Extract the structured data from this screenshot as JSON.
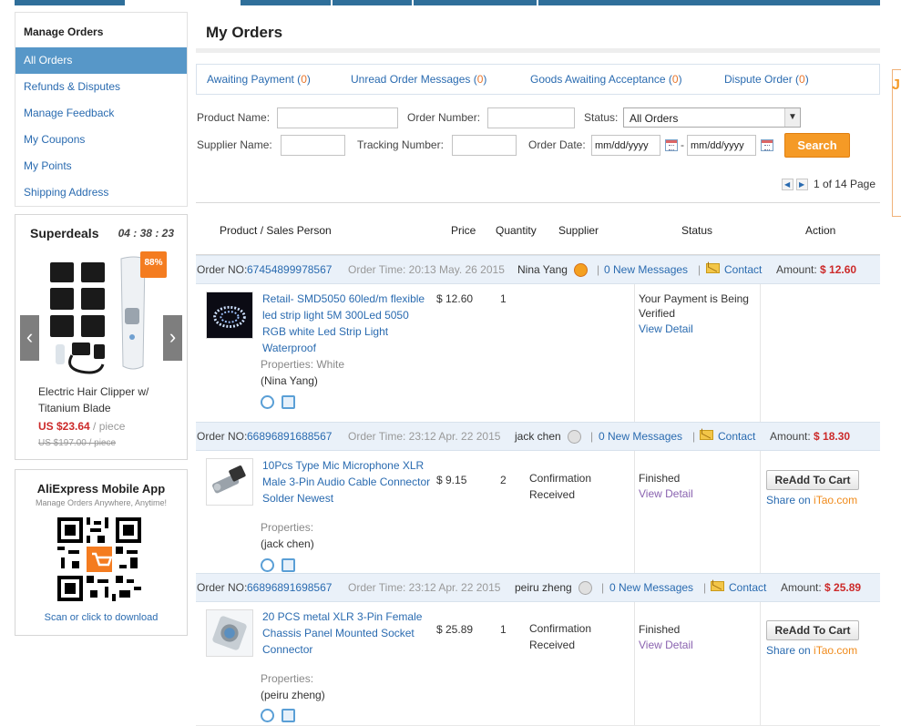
{
  "sidebar": {
    "title": "Manage Orders",
    "items": [
      {
        "label": "All Orders",
        "active": true
      },
      {
        "label": "Refunds & Disputes",
        "active": false
      },
      {
        "label": "Manage Feedback",
        "active": false
      },
      {
        "label": "My Coupons",
        "active": false
      },
      {
        "label": "My Points",
        "active": false
      },
      {
        "label": "Shipping Address",
        "active": false
      }
    ]
  },
  "superdeals": {
    "title": "Superdeals",
    "timer": "04 : 38 : 23",
    "discount": "88%",
    "product_name": "Electric Hair Clipper w/ Titanium Blade",
    "price": "US $23.64",
    "price_unit": " / piece",
    "old_price": "US $197.00 / piece"
  },
  "mobile_app": {
    "title": "AliExpress Mobile App",
    "subtitle": "Manage Orders Anywhere, Anytime!",
    "scan_text": "Scan or click to download"
  },
  "main": {
    "title": "My Orders",
    "tabs": [
      {
        "label": "Awaiting Payment",
        "count": "0"
      },
      {
        "label": "Unread Order Messages",
        "count": "0"
      },
      {
        "label": "Goods Awaiting Acceptance",
        "count": "0"
      },
      {
        "label": "Dispute Order",
        "count": "0"
      }
    ],
    "filters": {
      "product_name_label": "Product Name:",
      "order_number_label": "Order Number:",
      "status_label": "Status:",
      "status_value": "All Orders",
      "supplier_name_label": "Supplier Name:",
      "tracking_number_label": "Tracking Number:",
      "order_date_label": "Order Date:",
      "date_placeholder": "mm/dd/yyyy",
      "date_sep": "-",
      "search_label": "Search"
    },
    "pager": {
      "text": "1 of 14 Page"
    },
    "table_headers": {
      "product": "Product / Sales Person",
      "price": "Price",
      "quantity": "Quantity",
      "supplier": "Supplier",
      "status": "Status",
      "action": "Action"
    },
    "orders": [
      {
        "label": "Order NO:",
        "number": "67454899978567",
        "time": "Order Time: 20:13 May. 26 2015",
        "seller": "Nina Yang",
        "messages": "0 New Messages",
        "contact": "Contact",
        "amount_label": "Amount:",
        "amount": "$ 12.60",
        "product_name": "Retail- SMD5050 60led/m flexible led strip light 5M 300Led 5050 RGB white Led Strip Light Waterproof",
        "properties": "Properties: White",
        "seller_line": "(Nina Yang)",
        "price": "$ 12.60",
        "quantity": "1",
        "supplier_status": "",
        "status": "Your Payment is Being Verified",
        "view_detail": "View Detail",
        "readd": "",
        "share": "",
        "share_brand": ""
      },
      {
        "label": "Order NO:",
        "number": "66896891688567",
        "time": "Order Time: 23:12 Apr. 22 2015",
        "seller": "jack chen",
        "messages": "0 New Messages",
        "contact": "Contact",
        "amount_label": "Amount:",
        "amount": "$ 18.30",
        "product_name": "10Pcs Type Mic Microphone XLR Male 3-Pin Audio Cable Connector Solder Newest",
        "properties": "Properties:",
        "seller_line": "(jack chen)",
        "price": "$ 9.15",
        "quantity": "2",
        "supplier_status": "Confirmation Received",
        "status": "Finished",
        "view_detail": "View Detail",
        "readd": "ReAdd To Cart",
        "share": "Share on ",
        "share_brand": "iTao.com"
      },
      {
        "label": "Order NO:",
        "number": "66896891698567",
        "time": "Order Time: 23:12 Apr. 22 2015",
        "seller": "peiru zheng",
        "messages": "0 New Messages",
        "contact": "Contact",
        "amount_label": "Amount:",
        "amount": "$ 25.89",
        "product_name": "20 PCS metal XLR 3-Pin Female Chassis Panel Mounted Socket Connector",
        "properties": "Properties:",
        "seller_line": "(peiru zheng)",
        "price": "$ 25.89",
        "quantity": "1",
        "supplier_status": "Confirmation Received",
        "status": "Finished",
        "view_detail": "View Detail",
        "readd": "ReAdd To Cart",
        "share": "Share on ",
        "share_brand": "iTao.com"
      }
    ]
  },
  "colors": {
    "link": "#2a6bb0",
    "active_menu": "#5797c8",
    "amount": "#cc2a2a",
    "search_button": "#f59a26",
    "order_bar": "#eaf1f9"
  }
}
